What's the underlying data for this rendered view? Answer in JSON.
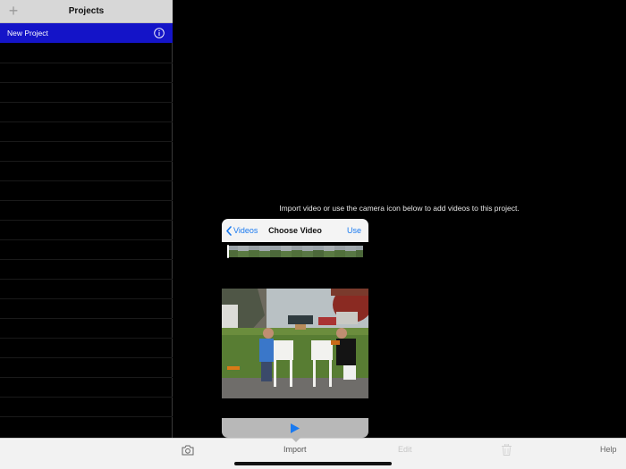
{
  "sidebar": {
    "title": "Projects",
    "add_icon": "plus-icon",
    "projects": [
      {
        "name": "New Project",
        "info_icon": "info-icon"
      }
    ]
  },
  "main": {
    "hint": "Import video or use the camera icon below to add videos to this project."
  },
  "picker": {
    "back_label": "Videos",
    "title": "Choose Video",
    "use_label": "Use",
    "play_icon": "play-icon",
    "accent": "#1a7af0"
  },
  "toolbar": {
    "camera_icon": "camera-icon",
    "import_label": "Import",
    "edit_label": "Edit",
    "trash_icon": "trash-icon",
    "help_label": "Help"
  },
  "colors": {
    "selection": "#1414c8",
    "background": "#000000",
    "toolbar": "#f2f2f2"
  }
}
